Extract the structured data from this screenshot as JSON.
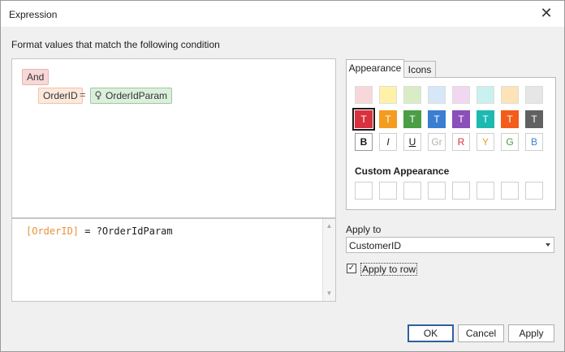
{
  "window": {
    "title": "Expression"
  },
  "condition_label": "Format values that match the following condition",
  "filter": {
    "group_operator": "And",
    "field": "OrderID",
    "operator_symbol": "=",
    "parameter": "OrderIdParam"
  },
  "expression": {
    "field_token": "[OrderID]",
    "rest": " = ?OrderIdParam"
  },
  "tabs": {
    "appearance": "Appearance",
    "icons": "Icons"
  },
  "appearance": {
    "light_colors": [
      "#f8d7da",
      "#fff2a8",
      "#d9ecc6",
      "#d6e7f8",
      "#f2d7f0",
      "#c9f1ef",
      "#fde3b6",
      "#e6e6e6"
    ],
    "strong_colors": [
      "#d9313d",
      "#f39c1f",
      "#4a9e45",
      "#3b7ed1",
      "#8a4fb8",
      "#1cbab0",
      "#f35c1b",
      "#616161"
    ],
    "strong_letter": "T",
    "selected_index": 0,
    "font_styles": [
      {
        "label": "B",
        "color": "#1a1a1a"
      },
      {
        "label": "I",
        "color": "#1a1a1a"
      },
      {
        "label": "U",
        "color": "#1a1a1a"
      },
      {
        "label": "Gr",
        "color": "#b3b3b3"
      },
      {
        "label": "R",
        "color": "#d9313d"
      },
      {
        "label": "Y",
        "color": "#e8a21a"
      },
      {
        "label": "G",
        "color": "#4a9e45"
      },
      {
        "label": "B",
        "color": "#3b7ed1"
      }
    ],
    "custom_label": "Custom Appearance"
  },
  "apply_to": {
    "label": "Apply to",
    "value": "CustomerID"
  },
  "apply_to_row": {
    "label": "Apply to row",
    "checked": true
  },
  "buttons": {
    "ok": "OK",
    "cancel": "Cancel",
    "apply": "Apply"
  }
}
